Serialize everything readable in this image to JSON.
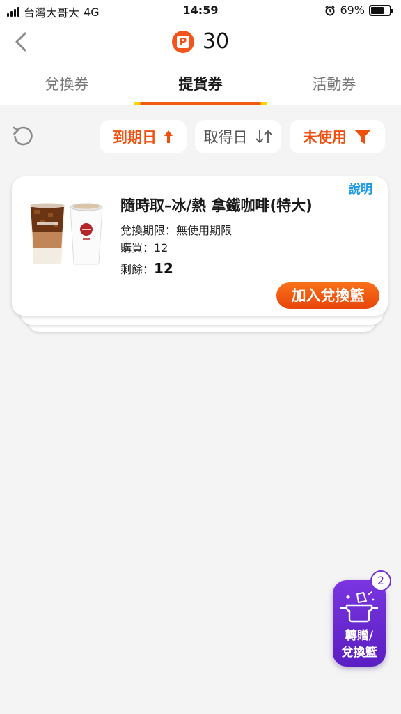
{
  "status_bar": {
    "carrier": "台灣大哥大",
    "network": "4G",
    "time": "14:59",
    "battery": "69%",
    "battery_level": 0.69
  },
  "header": {
    "points_badge_letter": "P",
    "points": "30"
  },
  "tabs": [
    {
      "label": "兌換券",
      "active": false
    },
    {
      "label": "提貨券",
      "active": true
    },
    {
      "label": "活動券",
      "active": false
    }
  ],
  "filters": {
    "expiry_label": "到期日",
    "acquired_label": "取得日",
    "unused_label": "未使用"
  },
  "card": {
    "help_label": "說明",
    "title": "隨時取–冰/熱 拿鐵咖啡(特大)",
    "period_label": "兌換期限：無使用期限",
    "purchase_label": "購買：12",
    "remaining_label": "剩餘：",
    "remaining_value": "12",
    "add_button_label": "加入兌換籃"
  },
  "basket": {
    "count": "2",
    "label_line1": "轉贈/",
    "label_line2": "兌換籃"
  },
  "colors": {
    "accent": "#f04f0e",
    "link": "#1e9be4",
    "basket": "#6a2bd6"
  }
}
